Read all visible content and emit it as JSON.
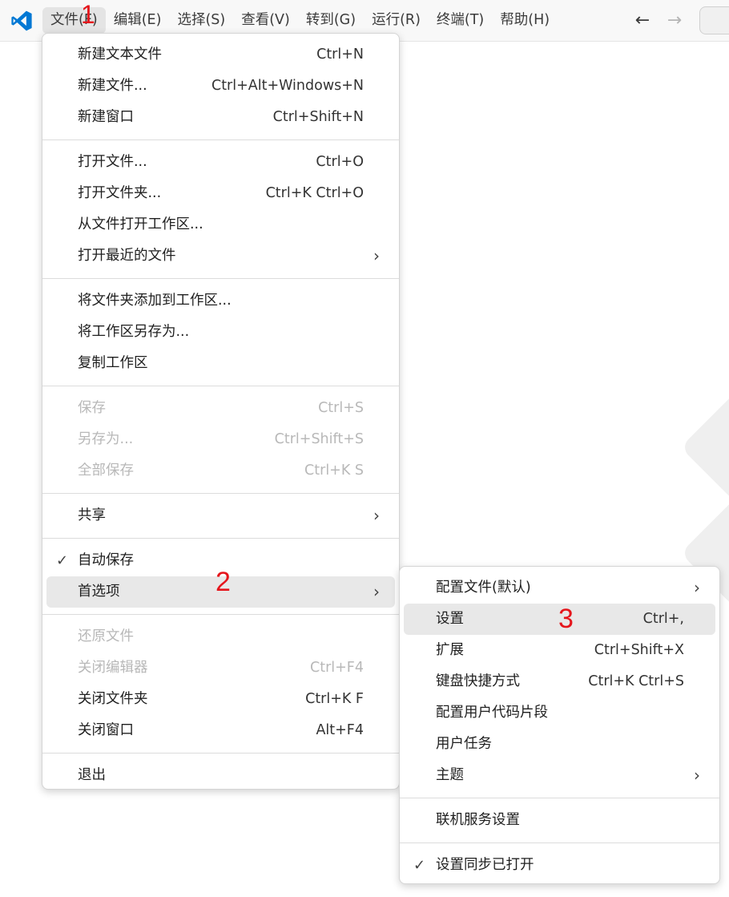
{
  "menubar": {
    "items": [
      "文件(F)",
      "编辑(E)",
      "选择(S)",
      "查看(V)",
      "转到(G)",
      "运行(R)",
      "终端(T)",
      "帮助(H)"
    ]
  },
  "nav": {
    "back": "←",
    "forward": "→"
  },
  "file_menu": {
    "groups": [
      [
        {
          "label": "新建文本文件",
          "shortcut": "Ctrl+N"
        },
        {
          "label": "新建文件...",
          "shortcut": "Ctrl+Alt+Windows+N"
        },
        {
          "label": "新建窗口",
          "shortcut": "Ctrl+Shift+N"
        }
      ],
      [
        {
          "label": "打开文件...",
          "shortcut": "Ctrl+O"
        },
        {
          "label": "打开文件夹...",
          "shortcut": "Ctrl+K Ctrl+O"
        },
        {
          "label": "从文件打开工作区...",
          "shortcut": ""
        },
        {
          "label": "打开最近的文件",
          "shortcut": "",
          "submenu": true
        }
      ],
      [
        {
          "label": "将文件夹添加到工作区...",
          "shortcut": ""
        },
        {
          "label": "将工作区另存为...",
          "shortcut": ""
        },
        {
          "label": "复制工作区",
          "shortcut": ""
        }
      ],
      [
        {
          "label": "保存",
          "shortcut": "Ctrl+S",
          "disabled": true
        },
        {
          "label": "另存为...",
          "shortcut": "Ctrl+Shift+S",
          "disabled": true
        },
        {
          "label": "全部保存",
          "shortcut": "Ctrl+K S",
          "disabled": true
        }
      ],
      [
        {
          "label": "共享",
          "shortcut": "",
          "submenu": true
        }
      ],
      [
        {
          "label": "自动保存",
          "shortcut": "",
          "checked": true
        },
        {
          "label": "首选项",
          "shortcut": "",
          "submenu": true,
          "highlight": true
        }
      ],
      [
        {
          "label": "还原文件",
          "shortcut": "",
          "disabled": true
        },
        {
          "label": "关闭编辑器",
          "shortcut": "Ctrl+F4",
          "disabled": true
        },
        {
          "label": "关闭文件夹",
          "shortcut": "Ctrl+K F"
        },
        {
          "label": "关闭窗口",
          "shortcut": "Alt+F4"
        }
      ],
      [
        {
          "label": "退出",
          "shortcut": ""
        }
      ]
    ]
  },
  "preferences_menu": {
    "groups": [
      [
        {
          "label": "配置文件(默认)",
          "shortcut": "",
          "submenu": true
        },
        {
          "label": "设置",
          "shortcut": "Ctrl+,",
          "highlight": true
        },
        {
          "label": "扩展",
          "shortcut": "Ctrl+Shift+X"
        },
        {
          "label": "键盘快捷方式",
          "shortcut": "Ctrl+K Ctrl+S"
        },
        {
          "label": "配置用户代码片段",
          "shortcut": ""
        },
        {
          "label": "用户任务",
          "shortcut": ""
        },
        {
          "label": "主题",
          "shortcut": "",
          "submenu": true
        }
      ],
      [
        {
          "label": "联机服务设置",
          "shortcut": ""
        }
      ],
      [
        {
          "label": "设置同步已打开",
          "shortcut": "",
          "checked": true
        }
      ]
    ]
  },
  "annotations": [
    "1",
    "2",
    "3"
  ],
  "colors": {
    "annotation": "#e5161c",
    "highlight": "#e8e8e8",
    "disabled_text": "#b8b8b8",
    "vscode_blue": "#0078d4"
  }
}
